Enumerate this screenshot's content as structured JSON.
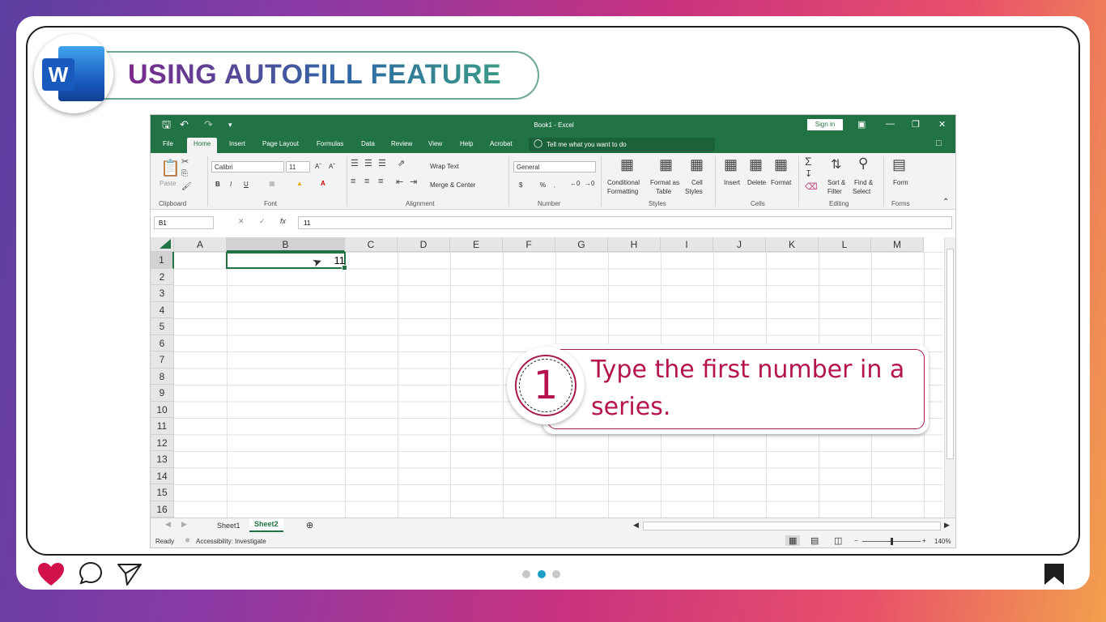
{
  "banner": {
    "title": "USING AUTOFILL FEATURE",
    "logo_letter": "W",
    "logo_icon": "word-logo-icon"
  },
  "excel": {
    "title": "Book1  -  Excel",
    "sign_in": "Sign in",
    "tabs": [
      "File",
      "Home",
      "Insert",
      "Page Layout",
      "Formulas",
      "Data",
      "Review",
      "View",
      "Help",
      "Acrobat"
    ],
    "active_tab": "Home",
    "tell_me": "Tell me what you want to do",
    "ribbon": {
      "clipboard": {
        "paste": "Paste",
        "label": "Clipboard"
      },
      "font": {
        "name": "Calibri",
        "size": "11",
        "label": "Font",
        "bold": "B",
        "italic": "I",
        "underline": "U"
      },
      "alignment": {
        "wrap": "Wrap Text",
        "merge": "Merge & Center",
        "label": "Alignment"
      },
      "number": {
        "format": "General",
        "currency": "$",
        "percent": "%",
        "label": "Number"
      },
      "styles": {
        "conditional": "Conditional",
        "formatting": "Formatting",
        "format_as": "Format as",
        "table": "Table",
        "cell": "Cell",
        "cell_styles": "Styles",
        "label": "Styles"
      },
      "cells": {
        "insert": "Insert",
        "delete": "Delete",
        "format": "Format",
        "label": "Cells"
      },
      "editing": {
        "sort": "Sort &",
        "filter": "Filter",
        "find": "Find &",
        "select": "Select",
        "label": "Editing"
      },
      "forms": {
        "form": "Form",
        "label": "Forms"
      }
    },
    "name_box": "B1",
    "formula_value": "11",
    "fx": "fx",
    "columns": [
      "A",
      "B",
      "C",
      "D",
      "E",
      "F",
      "G",
      "H",
      "I",
      "J",
      "K",
      "L",
      "M"
    ],
    "selected_column": "B",
    "rows": [
      "1",
      "2",
      "3",
      "4",
      "5",
      "6",
      "7",
      "8",
      "9",
      "10",
      "11",
      "12",
      "13",
      "14",
      "15",
      "16"
    ],
    "cell_b1": "11",
    "sheets": [
      "Sheet1",
      "Sheet2"
    ],
    "active_sheet": "Sheet2",
    "status": {
      "ready": "Ready",
      "accessibility": "Accessibility: Investigate",
      "zoom": "140%"
    }
  },
  "callout": {
    "step": "1",
    "text": "Type the first number in a series."
  },
  "pager": {
    "total": 3,
    "active": 2
  },
  "colors": {
    "excel_green": "#217346",
    "callout_accent": "#b5144f"
  }
}
